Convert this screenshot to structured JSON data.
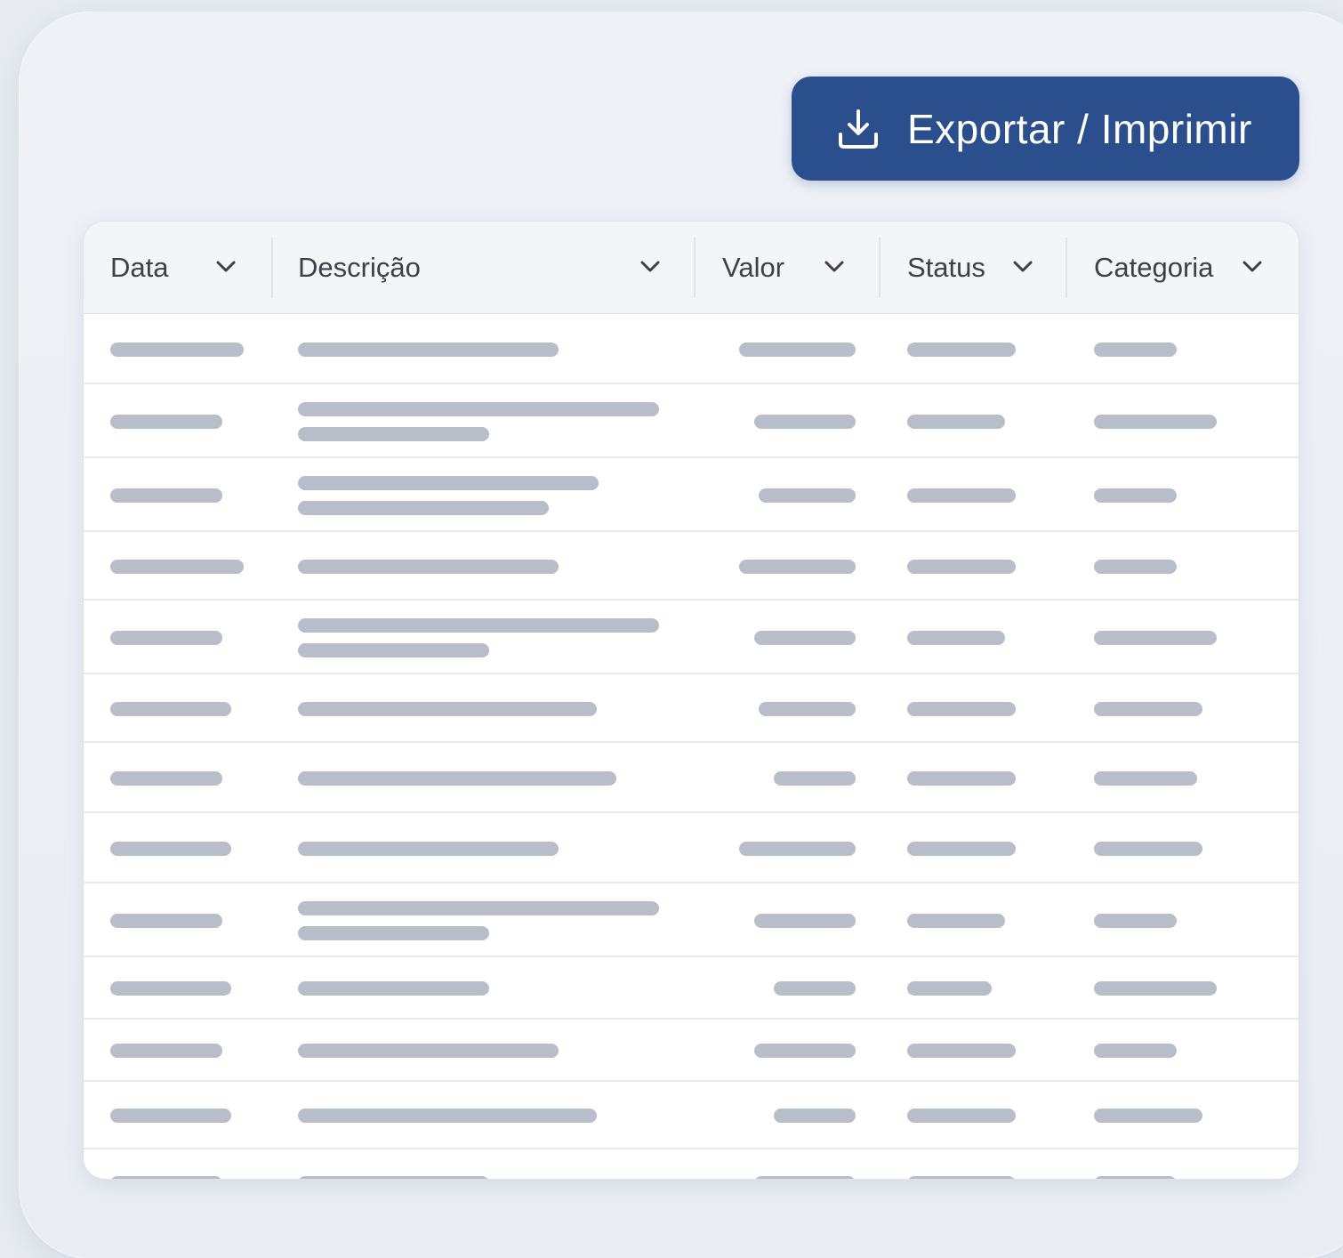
{
  "toolbar": {
    "export_label": "Exportar / Imprimir",
    "export_icon": "download-icon",
    "accent_color": "#2b4e8c"
  },
  "table": {
    "columns": [
      {
        "key": "data",
        "label": "Data"
      },
      {
        "key": "descricao",
        "label": "Descrição"
      },
      {
        "key": "valor",
        "label": "Valor"
      },
      {
        "key": "status",
        "label": "Status"
      },
      {
        "key": "categoria",
        "label": "Categoria"
      }
    ],
    "column_icon": "chevron-down-icon",
    "row_state": "loading-skeleton",
    "skeleton_color": "#b8bec9"
  }
}
